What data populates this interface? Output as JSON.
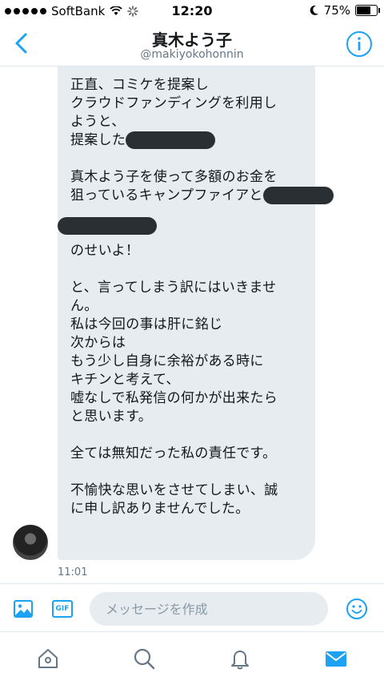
{
  "status_bar": {
    "carrier": "SoftBank",
    "time": "12:20",
    "battery": "75%",
    "battery_level": 0.75,
    "signal_bars": 5
  },
  "header": {
    "title": "真木よう子",
    "handle": "@makiyokohonnin"
  },
  "message": {
    "lines": [
      "正直、コミケを提案し",
      "クラウドファンディングを利用し",
      "ようと、",
      "提案した",
      "",
      "真木よう子を使って多額のお金を",
      "狙っているキャンプファイアと",
      "",
      "",
      "のせいよ！",
      "",
      "と、言ってしまう訳にはいきませ",
      "ん。",
      "私は今回の事は肝に銘じ",
      "次からは",
      "もう少し自身に余裕がある時に",
      "キチンと考えて、",
      "嘘なしで私発信の何かが出来たら",
      "と思います。",
      "",
      "全ては無知だった私の責任です。",
      "",
      "不愉快な思いをさせてしまい、誠",
      "に申し訳ありませんでした。"
    ],
    "timestamp": "11:01"
  },
  "composer": {
    "placeholder": "メッセージを作成",
    "gif_label": "GIF"
  },
  "icons": {
    "back": "chevron-left-icon",
    "info": "info-icon",
    "image": "image-icon",
    "emoji": "emoji-icon",
    "home": "home-icon",
    "search": "search-icon",
    "notifications": "bell-icon",
    "messages": "mail-icon"
  },
  "colors": {
    "accent": "#1da1f2",
    "bubble": "#e6ecf0",
    "muted": "#657786"
  }
}
